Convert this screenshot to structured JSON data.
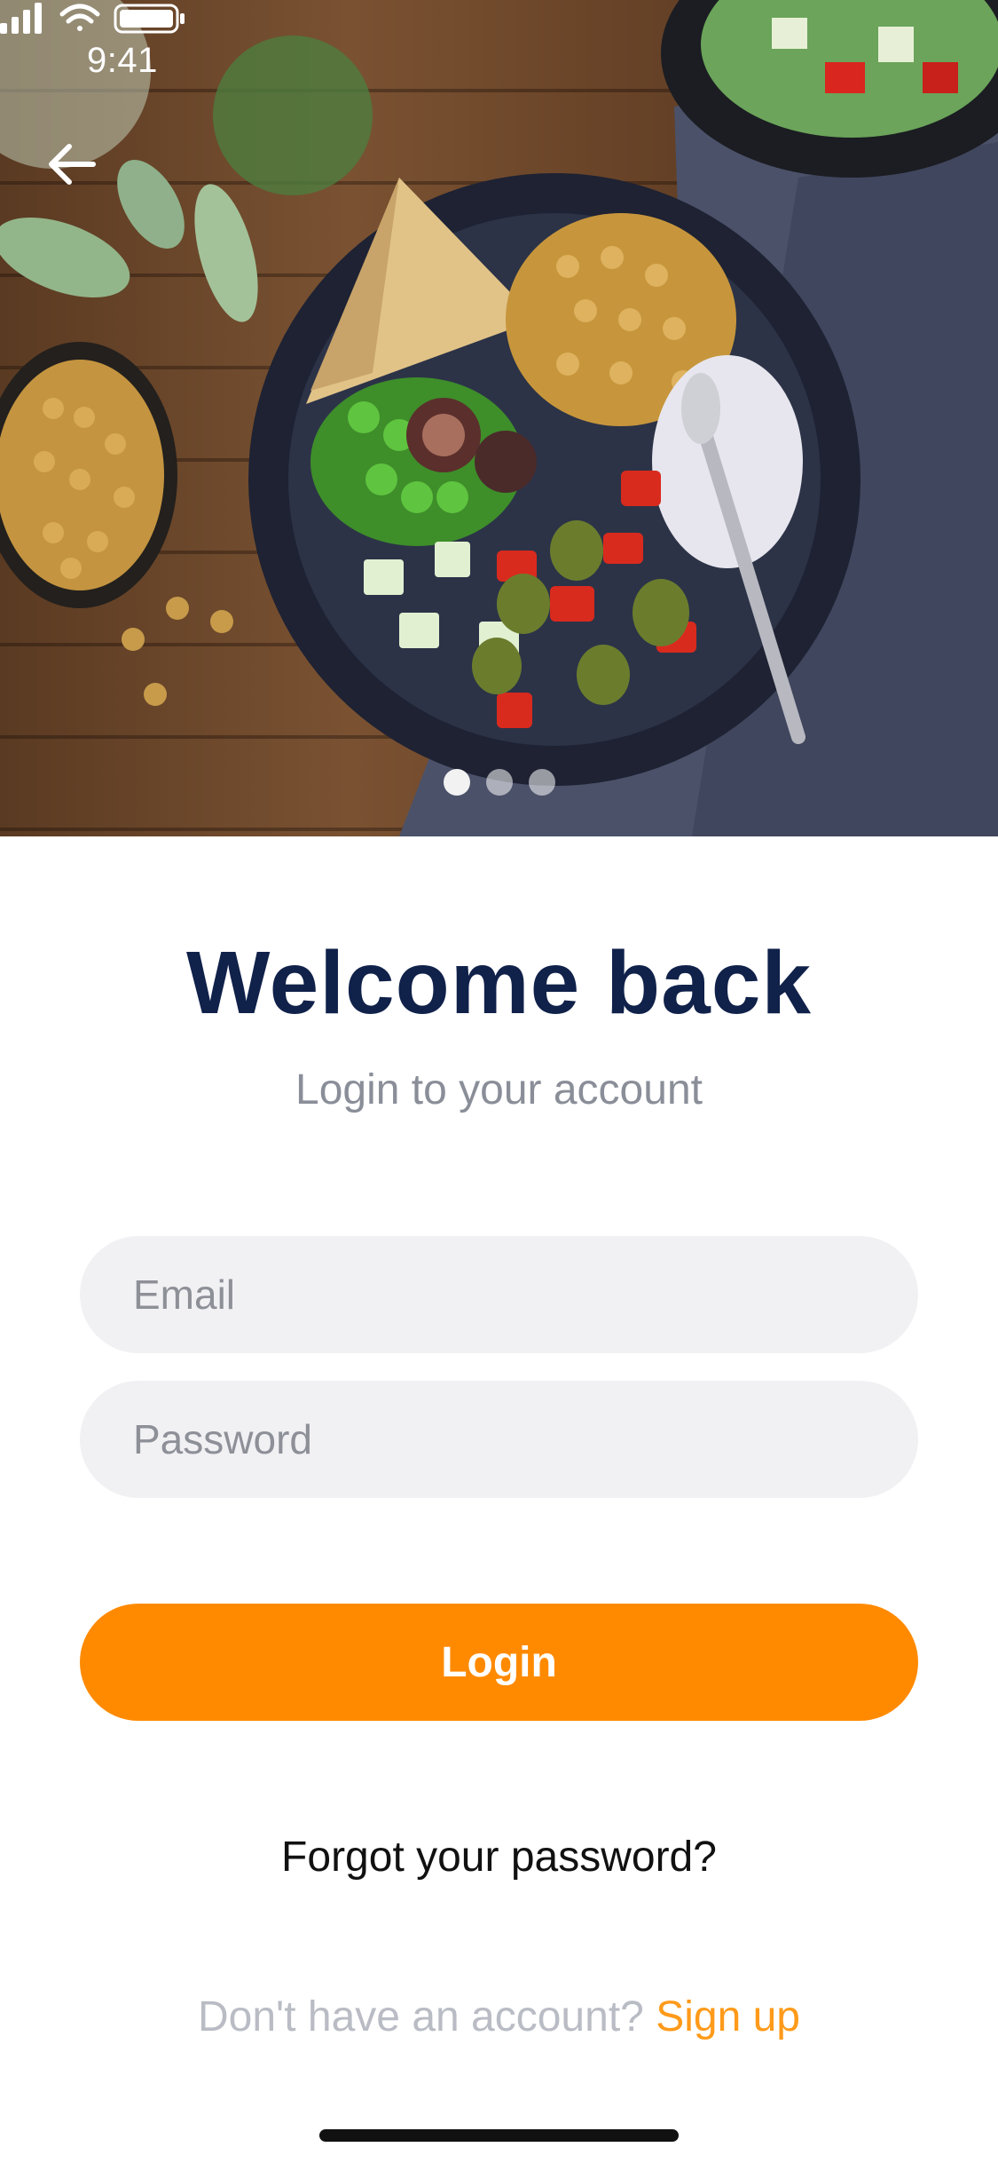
{
  "status_bar": {
    "time": "9:41",
    "icons": [
      "signal-icon",
      "wifi-icon",
      "battery-icon"
    ]
  },
  "hero": {
    "back_icon": "arrow-left-icon",
    "pager": {
      "count": 3,
      "active_index": 0
    }
  },
  "login": {
    "title": "Welcome back",
    "subtitle": "Login to your account",
    "email_placeholder": "Email",
    "password_placeholder": "Password",
    "login_label": "Login",
    "forgot_label": "Forgot your password?",
    "signup_prompt": "Don't have an account?",
    "signup_label": "Sign up"
  },
  "colors": {
    "title": "#10214a",
    "accent": "#ff8a00",
    "field_bg": "#f1f1f4",
    "muted_text": "#8a8e98"
  }
}
